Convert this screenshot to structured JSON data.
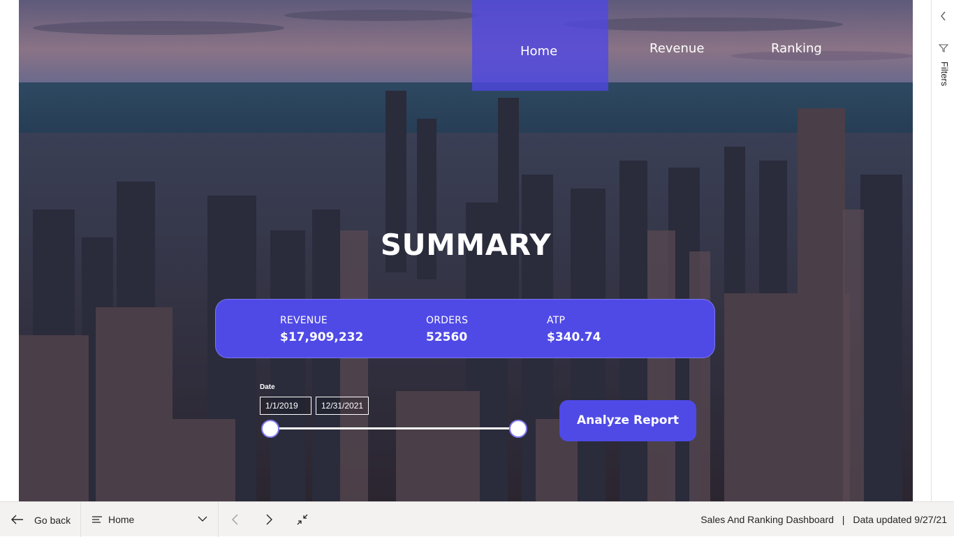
{
  "nav": {
    "items": [
      {
        "label": "Home",
        "active": true
      },
      {
        "label": "Revenue",
        "active": false
      },
      {
        "label": "Ranking",
        "active": false
      }
    ]
  },
  "main": {
    "title": "SUMMARY",
    "kpis": [
      {
        "label": "REVENUE",
        "value": "$17,909,232"
      },
      {
        "label": "ORDERS",
        "value": "52560"
      },
      {
        "label": "ATP",
        "value": "$340.74"
      }
    ],
    "date_filter": {
      "label": "Date",
      "start": "1/1/2019",
      "end": "12/31/2021"
    },
    "analyze_button": "Analyze Report"
  },
  "filters_pane": {
    "label": "Filters"
  },
  "bottom_bar": {
    "go_back": "Go back",
    "current_page": "Home",
    "report_name": "Sales And Ranking Dashboard",
    "separator": "|",
    "data_updated": "Data updated 9/27/21"
  },
  "colors": {
    "accent": "#4f4ae6",
    "text_light": "#ffffff",
    "bar_bg": "#f3f2f1"
  }
}
